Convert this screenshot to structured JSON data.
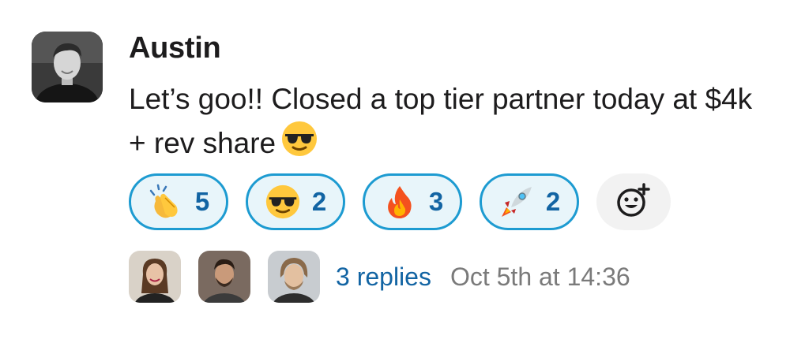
{
  "message": {
    "author": "Austin",
    "text": "Let’s goo!! Closed a top tier partner today at $4k + rev share",
    "inline_emoji": "smiling-face-with-sunglasses"
  },
  "reactions": [
    {
      "emoji": "clapping-hands",
      "count": "5"
    },
    {
      "emoji": "smiling-face-with-sunglasses",
      "count": "2"
    },
    {
      "emoji": "fire",
      "count": "3"
    },
    {
      "emoji": "rocket",
      "count": "2"
    }
  ],
  "add_reaction_icon": "add-emoji-icon",
  "thread": {
    "replies_label": "3 replies",
    "timestamp": "Oct 5th at 14:36"
  },
  "colors": {
    "reaction_border": "#1d9bd1",
    "reaction_bg": "#e8f5fa",
    "link": "#1264a3",
    "muted": "#7a7a7a"
  }
}
